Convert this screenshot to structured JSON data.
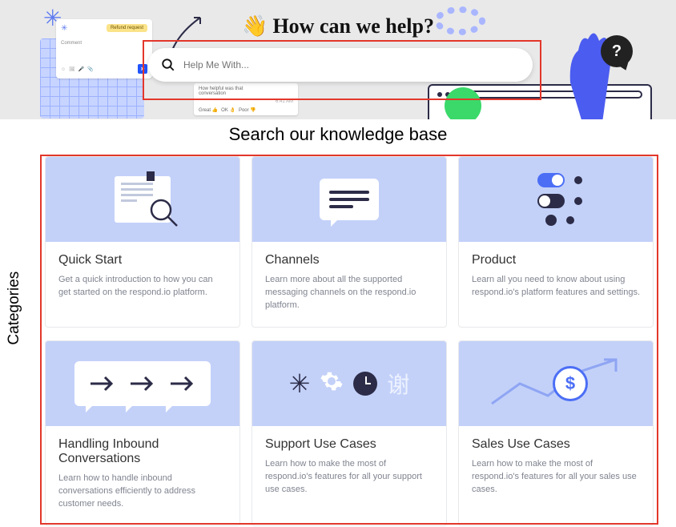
{
  "hero": {
    "title": "How can we help?",
    "wave_emoji": "👋",
    "search_placeholder": "Help Me With...",
    "deco_comment": {
      "chip": "Refund request",
      "label": "Comment"
    },
    "deco_feedback": {
      "question": "How helpful was that",
      "line2": "conversation",
      "time": "6:41 AM",
      "opt1": "Great 👍",
      "opt2": "OK 👌",
      "opt3": "Poor 👎"
    },
    "question_badge": "?"
  },
  "subtitle": "Search our knowledge base",
  "sidebar_label": "Categories",
  "categories": [
    {
      "title": "Quick Start",
      "desc": "Get a quick introduction to how you can get started on the respond.io platform."
    },
    {
      "title": "Channels",
      "desc": "Learn more about all the supported messaging channels on the respond.io platform."
    },
    {
      "title": "Product",
      "desc": "Learn all you need to know about using respond.io's platform features and settings."
    },
    {
      "title": "Handling Inbound Conversations",
      "desc": "Learn how to handle inbound conversations efficiently to address customer needs."
    },
    {
      "title": "Support Use Cases",
      "desc": "Learn how to make the most of respond.io's features for all your support use cases."
    },
    {
      "title": "Sales Use Cases",
      "desc": "Learn how to make the most of respond.io's features for all your sales use cases."
    }
  ]
}
